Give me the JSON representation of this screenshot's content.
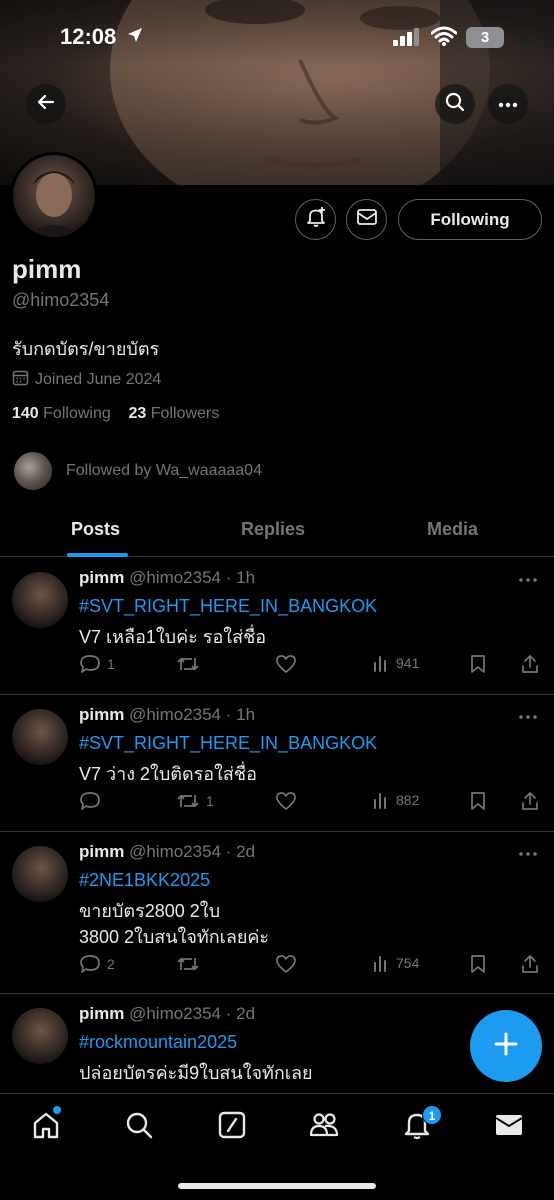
{
  "status_bar": {
    "time": "12:08",
    "battery": "3"
  },
  "profile": {
    "display_name": "pimm",
    "handle": "@himo2354",
    "bio": "รับกดบัตร/ขายบัตร",
    "joined": "Joined June 2024",
    "following_count": "140",
    "following_label": "Following",
    "followers_count": "23",
    "followers_label": "Followers",
    "followed_by": "Followed by Wa_waaaaa04",
    "follow_button_label": "Following"
  },
  "tabs": [
    {
      "label": "Posts",
      "active": true
    },
    {
      "label": "Replies",
      "active": false
    },
    {
      "label": "Media",
      "active": false
    }
  ],
  "posts": [
    {
      "name": "pimm",
      "meta": "@himo2354 · 1h",
      "lines": [
        "#SVT_RIGHT_HERE_IN_BANGKOK",
        "V7 เหลือ1ใบค่ะ รอใส่ชื่อ"
      ],
      "replies": "1",
      "reposts": "",
      "views": "941"
    },
    {
      "name": "pimm",
      "meta": "@himo2354 · 1h",
      "lines": [
        "#SVT_RIGHT_HERE_IN_BANGKOK",
        "V7 ว่าง 2ใบติดรอใส่ชื่อ"
      ],
      "replies": "",
      "reposts": "1",
      "views": "882"
    },
    {
      "name": "pimm",
      "meta": "@himo2354 · 2d",
      "lines": [
        "#2NE1BKK2025",
        "ขายบัตร2800 2ใบ",
        "3800 2ใบสนใจทักเลยค่ะ"
      ],
      "replies": "2",
      "reposts": "",
      "views": "754"
    },
    {
      "name": "pimm",
      "meta": "@himo2354 · 2d",
      "lines": [
        "#rockmountain2025",
        "ปล่อยบัตรค่ะมี9ใบสนใจทักเลย"
      ],
      "replies": "",
      "reposts": "",
      "views": ""
    }
  ],
  "nav": {
    "notifications_badge": "1"
  },
  "colors": {
    "accent": "#1d9bf0",
    "background": "#000000",
    "muted": "#71767b",
    "text": "#e7e9ea",
    "divider": "#2f3336"
  },
  "icons": [
    "back-arrow-icon",
    "search-icon",
    "more-icon",
    "bell-plus-icon",
    "mail-icon",
    "calendar-icon",
    "reply-icon",
    "repost-icon",
    "like-icon",
    "views-icon",
    "bookmark-icon",
    "share-icon",
    "plus-icon",
    "home-icon",
    "explore-icon",
    "grok-icon",
    "communities-icon",
    "notifications-icon",
    "messages-icon"
  ]
}
